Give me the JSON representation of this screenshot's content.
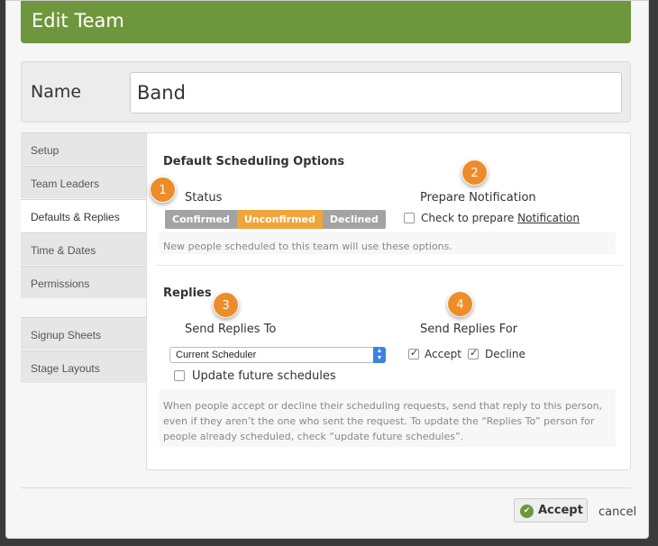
{
  "window": {
    "title": "Edit Team"
  },
  "name_field": {
    "label": "Name",
    "value": "Band"
  },
  "tabs": [
    {
      "label": "Setup",
      "active": false
    },
    {
      "label": "Team Leaders",
      "active": false
    },
    {
      "label": "Defaults & Replies",
      "active": true
    },
    {
      "label": "Time & Dates",
      "active": false
    },
    {
      "label": "Permissions",
      "active": false
    }
  ],
  "tabs_secondary": [
    {
      "label": "Signup Sheets"
    },
    {
      "label": "Stage Layouts"
    }
  ],
  "defaults": {
    "section_title": "Default Scheduling Options",
    "status_label": "Status",
    "status_options": [
      "Confirmed",
      "Unconfirmed",
      "Declined"
    ],
    "status_selected": "Unconfirmed",
    "notification_label": "Prepare Notification",
    "notification_check_text": "Check to prepare",
    "notification_link": "Notification",
    "notification_checked": false,
    "note": "New people scheduled to this team will use these options."
  },
  "replies": {
    "section_title": "Replies",
    "send_to_label": "Send Replies To",
    "send_to_value": "Current Scheduler",
    "update_future_label": "Update future schedules",
    "update_future_checked": false,
    "send_for_label": "Send Replies For",
    "accept_label": "Accept",
    "accept_checked": true,
    "decline_label": "Decline",
    "decline_checked": true,
    "note": "When people accept or decline their scheduling requests, send that reply to this person, even if they aren’t the one who sent the request. To update the “Replies To” person for people already scheduled, check “update future schedules”."
  },
  "badges": [
    "1",
    "2",
    "3",
    "4"
  ],
  "footer": {
    "accept_label": "Accept",
    "cancel_label": "cancel"
  },
  "colors": {
    "header_green": "#6e963c",
    "status_selected": "#f0a53a",
    "status_default": "#a3a3a3",
    "badge_orange": "#ec8d2a"
  }
}
